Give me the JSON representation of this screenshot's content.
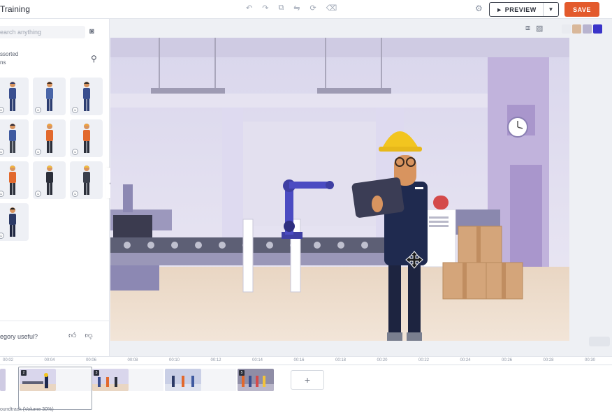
{
  "header": {
    "title": "Training",
    "preview_label": "► PREVIEW",
    "save_label": "SAVE"
  },
  "sidebar": {
    "search_placeholder": "earch anything",
    "section_label": "ssorted",
    "section_sub": "ns",
    "feedback_question": "egory useful?",
    "characters": [
      {
        "hair": "#2b3a6b",
        "shirt": "#3a4f8f",
        "pants": "#2c3d70"
      },
      {
        "hair": "#3b2a1f",
        "shirt": "#4a66a8",
        "pants": "#2c3d70"
      },
      {
        "hair": "#2a2a2a",
        "shirt": "#3a4f8f",
        "pants": "#2c3d70"
      },
      {
        "hair": "#2b2b3a",
        "shirt": "#3f5aa0",
        "pants": "#3a3f4b"
      },
      {
        "hair": "#f0a33a",
        "shirt": "#e2692d",
        "pants": "#2b2f3a"
      },
      {
        "hair": "#f0a33a",
        "shirt": "#e2692d",
        "pants": "#2b2f3a"
      },
      {
        "hair": "#f2b73a",
        "shirt": "#e2692d",
        "pants": "#2b2f3a"
      },
      {
        "hair": "#f2c33a",
        "shirt": "#2b2f3a",
        "pants": "#2b2f3a"
      },
      {
        "hair": "#f2c33a",
        "shirt": "#3a3f4b",
        "pants": "#2b2f3a"
      },
      {
        "hair": "#1f1f1f",
        "shirt": "#2c3a66",
        "pants": "#1f2640"
      }
    ]
  },
  "canvas": {
    "swatches": [
      "#e9ebf0",
      "#d9b89a",
      "#b8b4cf",
      "#3a34c9"
    ],
    "zoom_label": ""
  },
  "timeline": {
    "ticks": [
      "00:02",
      "00:04",
      "00:06",
      "00:08",
      "00:10",
      "00:12",
      "00:14",
      "00:16",
      "00:18",
      "00:20",
      "00:22",
      "00:24",
      "00:26",
      "00:28",
      "00:30"
    ],
    "scene_numbers": [
      "2",
      "3",
      "5"
    ],
    "soundtrack_label": "oundtrack (Volume 30%)"
  }
}
